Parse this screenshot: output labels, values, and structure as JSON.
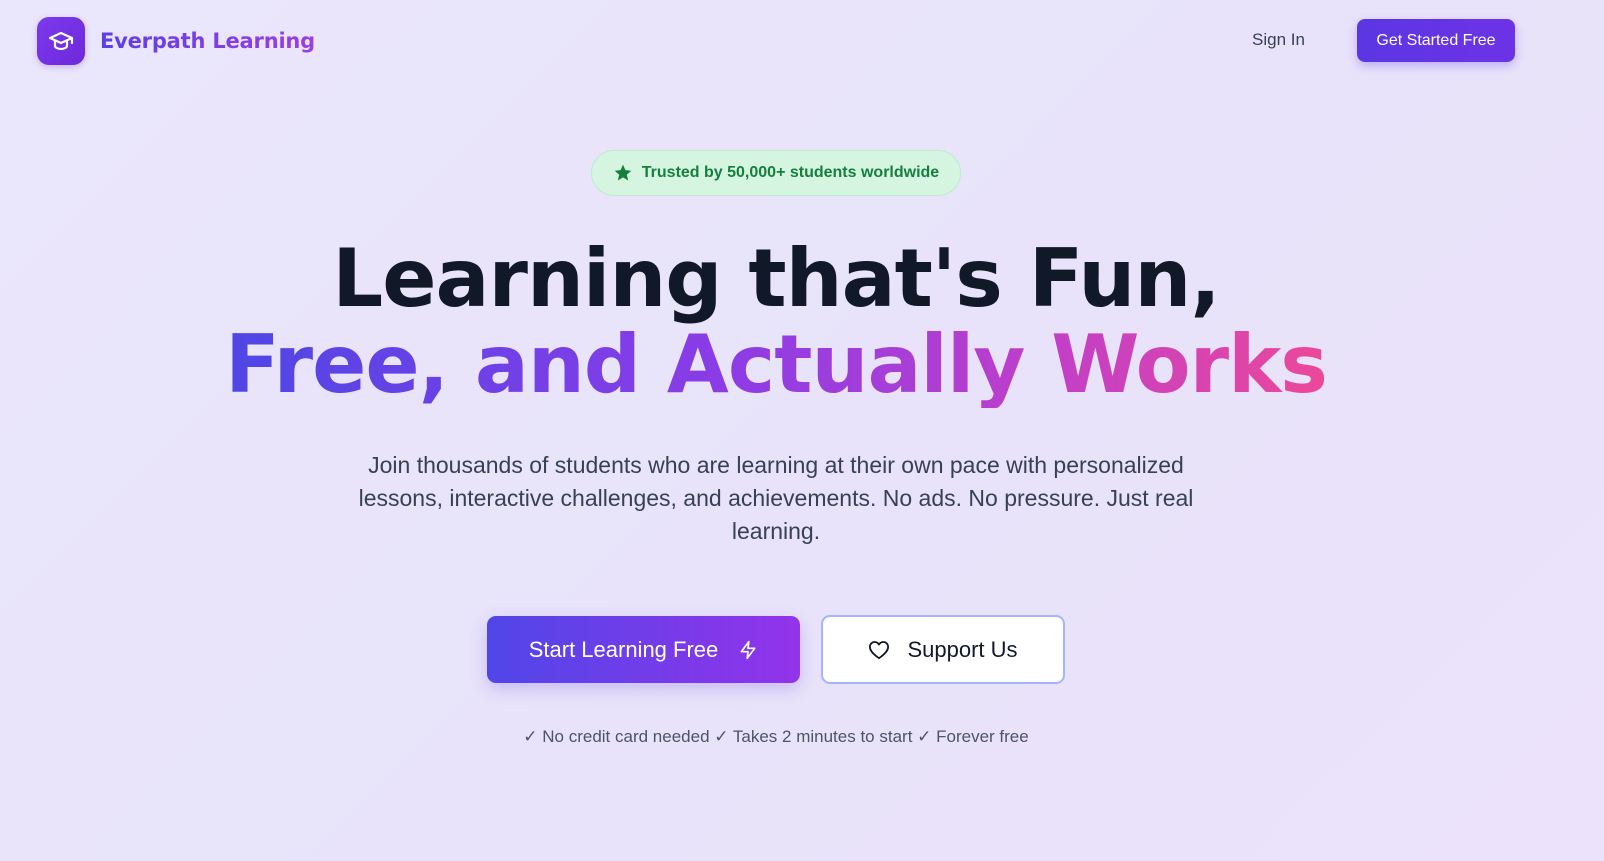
{
  "header": {
    "brand": "Everpath Learning",
    "logo_icon": "graduation-cap-icon",
    "signin_label": "Sign In",
    "cta_label": "Get Started Free"
  },
  "hero": {
    "badge_icon": "star-icon",
    "badge_text": "Trusted by 50,000+ students worldwide",
    "headline_line1": "Learning that's Fun,",
    "headline_line2": "Free, and Actually Works",
    "subtext": "Join thousands of students who are learning at their own pace with personalized lessons, interactive challenges, and achievements. No ads. No pressure. Just real learning.",
    "primary_button": "Start Learning Free",
    "primary_button_icon": "lightning-icon",
    "secondary_button": "Support Us",
    "secondary_button_icon": "heart-icon",
    "footnote": "✓ No credit card needed ✓ Takes 2 minutes to start ✓ Forever free"
  },
  "colors": {
    "brand_purple": "#6d28d9",
    "accent_indigo": "#5b36e3",
    "badge_green": "#15803d",
    "gradient_pink": "#ec4899"
  }
}
